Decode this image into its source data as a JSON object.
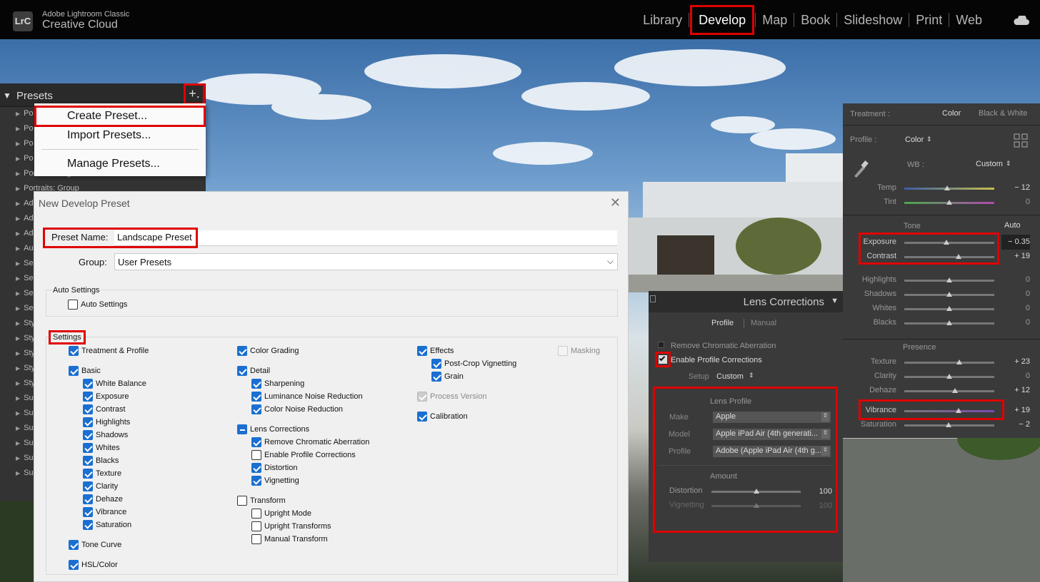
{
  "app": {
    "logo": "LrC",
    "title_line1": "Adobe Lightroom Classic",
    "title_line2": "Creative Cloud"
  },
  "modules": [
    "Library",
    "Develop",
    "Map",
    "Book",
    "Slideshow",
    "Print",
    "Web"
  ],
  "active_module": "Develop",
  "icons": {
    "cloud": "cloud-sync-icon",
    "eyedropper": "eyedropper-icon",
    "grid": "profile-grid-icon"
  },
  "presets": {
    "title": "Presets",
    "add_button": "+.",
    "items": [
      "Po",
      "Po",
      "Po",
      "Po",
      "Portraits: Bright",
      "Portraits: Group",
      "Ad",
      "Ad",
      "Ad",
      "Au",
      "Se",
      "Se",
      "Se",
      "Se",
      "Sty",
      "Sty",
      "Sty",
      "Sty",
      "Sty",
      "Su",
      "Su",
      "Su",
      "Su",
      "Su",
      "Su"
    ]
  },
  "preset_menu": {
    "items": [
      "Create Preset...",
      "Import Presets...",
      "Manage Presets..."
    ]
  },
  "dialog": {
    "title": "New Develop Preset",
    "close": "✕",
    "preset_name_label": "Preset Name:",
    "preset_name_value": "Landscape Preset",
    "group_label": "Group:",
    "group_value": "User Presets",
    "auto_settings_legend": "Auto Settings",
    "auto_settings_checkbox": "Auto Settings",
    "settings_legend": "Settings",
    "col1": [
      "Treatment & Profile",
      "Basic",
      "White Balance",
      "Exposure",
      "Contrast",
      "Highlights",
      "Shadows",
      "Whites",
      "Blacks",
      "Texture",
      "Clarity",
      "Dehaze",
      "Vibrance",
      "Saturation",
      "Tone Curve",
      "HSL/Color"
    ],
    "col2": [
      "Color Grading",
      "Detail",
      "Sharpening",
      "Luminance Noise Reduction",
      "Color Noise Reduction",
      "Lens Corrections",
      "Remove Chromatic Aberration",
      "Enable Profile Corrections",
      "Distortion",
      "Vignetting",
      "Transform",
      "Upright Mode",
      "Upright Transforms",
      "Manual Transform"
    ],
    "col3": [
      "Effects",
      "Post-Crop Vignetting",
      "Grain",
      "Process Version",
      "Calibration"
    ],
    "col4": [
      "Masking"
    ]
  },
  "lens": {
    "title": "Lens Corrections",
    "tabs": [
      "Profile",
      "Manual"
    ],
    "remove_ca": "Remove Chromatic Aberration",
    "enable_profile": "Enable Profile Corrections",
    "setup_label": "Setup",
    "setup_value": "Custom",
    "lens_profile_heading": "Lens Profile",
    "make_label": "Make",
    "make_value": "Apple",
    "model_label": "Model",
    "model_value": "Apple iPad Air (4th generati...",
    "profile_label": "Profile",
    "profile_value": "Adobe (Apple iPad Air (4th g...",
    "amount_heading": "Amount",
    "distortion_label": "Distortion",
    "distortion_value": "100",
    "vignetting_label": "Vignetting",
    "vignetting_value": "100"
  },
  "basic": {
    "treatment_label": "Treatment :",
    "treatment_color": "Color",
    "treatment_bw": "Black & White",
    "profile_label": "Profile :",
    "profile_value": "Color",
    "wb_label": "WB :",
    "wb_value": "Custom",
    "tone_heading": "Tone",
    "auto": "Auto",
    "presence_heading": "Presence",
    "sliders": {
      "temp": {
        "label": "Temp",
        "value": "− 12",
        "pos": 0.48
      },
      "tint": {
        "label": "Tint",
        "value": "0",
        "pos": 0.5
      },
      "exposure": {
        "label": "Exposure",
        "value": "− 0.35",
        "pos": 0.47
      },
      "contrast": {
        "label": "Contrast",
        "value": "+ 19",
        "pos": 0.6
      },
      "highlights": {
        "label": "Highlights",
        "value": "0",
        "pos": 0.5
      },
      "shadows": {
        "label": "Shadows",
        "value": "0",
        "pos": 0.5
      },
      "whites": {
        "label": "Whites",
        "value": "0",
        "pos": 0.5
      },
      "blacks": {
        "label": "Blacks",
        "value": "0",
        "pos": 0.5
      },
      "texture": {
        "label": "Texture",
        "value": "+ 23",
        "pos": 0.61
      },
      "clarity": {
        "label": "Clarity",
        "value": "0",
        "pos": 0.5
      },
      "dehaze": {
        "label": "Dehaze",
        "value": "+ 12",
        "pos": 0.56
      },
      "vibrance": {
        "label": "Vibrance",
        "value": "+ 19",
        "pos": 0.6
      },
      "saturation": {
        "label": "Saturation",
        "value": "− 2",
        "pos": 0.49
      }
    }
  }
}
